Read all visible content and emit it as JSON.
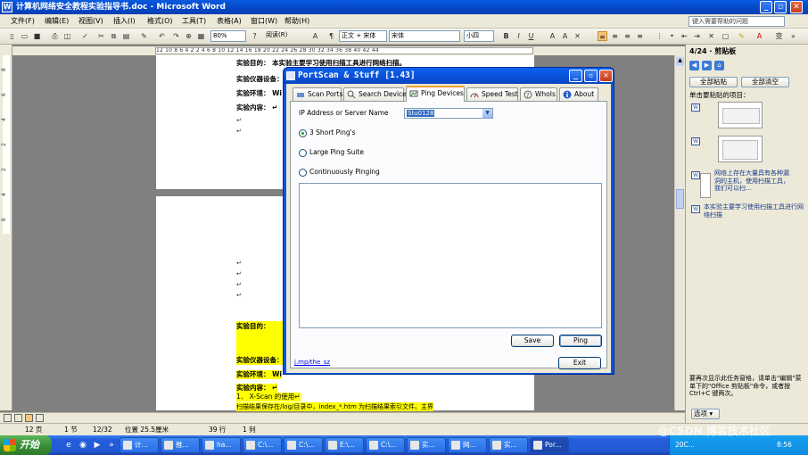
{
  "word": {
    "title": "计算机网络安全教程实验指导书.doc - Microsoft Word",
    "menu": [
      "文件(F)",
      "编辑(E)",
      "视图(V)",
      "插入(I)",
      "格式(O)",
      "工具(T)",
      "表格(A)",
      "窗口(W)",
      "帮助(H)"
    ],
    "help_placeholder": "键入需要帮助的问题",
    "toolbar": {
      "zoom": "80%",
      "read_mode": "阅读(R)",
      "style": "正文 + 宋体",
      "font": "宋体",
      "font_size": "小四"
    },
    "ruler_top": "12 10 8 6 4 2      2 4 6 8 10 12 14 16 18 20 22 24 26 28 30 32 34 36 38 40 42 44",
    "ruler_left": [
      "8",
      "6",
      "4",
      "2",
      "2",
      "4",
      "6"
    ],
    "page1": {
      "lines": [
        "实验目的：  本实验主要学习使用扫描工具进行网络扫描。",
        "实验仪器设备：",
        "实验环境：  Wi",
        "实验内容：  ↵"
      ],
      "marks": [
        "↵",
        "↵"
      ]
    },
    "page2": {
      "marks": [
        "↵",
        "↵",
        "↵",
        "↵"
      ],
      "lines": [
        "实验目的：",
        "实验仪器设备：",
        "实验环境：  Wi",
        "实验内容：  ↵",
        "1、 X-Scan 的使用↵",
        "扫描结果保存在/log/目录中，index_*.htm 为扫描结果索引文件。主界"
      ]
    },
    "taskpane": {
      "title": "4/24 · 剪贴板",
      "paste_all": "全部粘贴",
      "clear_all": "全部清空",
      "prompt": "单击要粘贴的项目：",
      "items": [
        "网络上存在大量具有各种漏洞的主机，使用扫描工具，我们可以扫...",
        "本实验主要学习使用扫描工具进行网络扫描"
      ],
      "footer": "要再次显示此任务窗格，请单击\"编辑\"菜单下的\"Office 剪贴板\"命令，或者按 Ctrl+C 键两次。",
      "options": "选项 ▾"
    },
    "status": {
      "page": "12 页",
      "section": "1 节",
      "pos": "12/32",
      "at": "位置 25.5厘米",
      "line": "39 行",
      "col": "1 列"
    }
  },
  "dialog": {
    "title": "PortScan & Stuff [1.43]",
    "tabs": [
      "Scan Ports",
      "Search Devices",
      "Ping Devices",
      "Speed Test",
      "WhoIs",
      "About"
    ],
    "active_tab": "Ping Devices",
    "ip_label": "IP Address or Server Name",
    "ip_value": "Stu0128",
    "options": [
      "3 Short Ping's",
      "Large Ping Suite",
      "Continuously Pinging"
    ],
    "selected_option": "3 Short Ping's",
    "save_label": "Save",
    "ping_label": "Ping",
    "exit_label": "Exit",
    "link": "j.mp/the_sz"
  },
  "taskbar": {
    "start": "开始",
    "tasks": [
      "计...",
      "推...",
      "ha...",
      "C:\\...",
      "C:\\...",
      "E:\\...",
      "C:\\...",
      "实...",
      "网...",
      "实...",
      "Por..."
    ],
    "clock": "8:56",
    "tray_label": "20C..."
  },
  "watermark": "@CSDN 博客技术社区"
}
